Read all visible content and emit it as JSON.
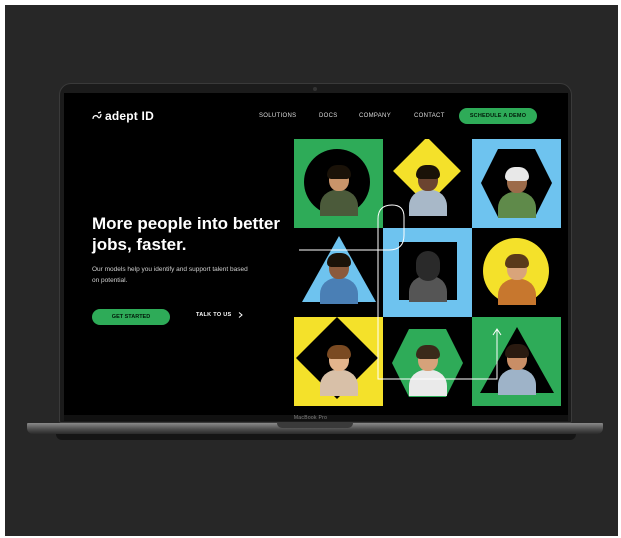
{
  "site": {
    "logo": "adept ID",
    "nav": {
      "solutions": "SOLUTIONS",
      "docs": "DOCS",
      "company": "COMPANY",
      "contact": "CONTACT",
      "demo": "SCHEDULE A DEMO"
    },
    "hero": {
      "headline": "More people into better jobs, faster.",
      "subtext": "Our models help you identify and support talent based on potential.",
      "primary_cta": "GET STARTED",
      "secondary_cta": "TALK TO US",
      "secondary_icon": "chevron-right-icon"
    }
  },
  "device": {
    "label": "MacBook Pro"
  },
  "colors": {
    "green": "#2eab58",
    "yellow": "#f4e12a",
    "blue": "#6ec3ef",
    "black": "#000000"
  }
}
